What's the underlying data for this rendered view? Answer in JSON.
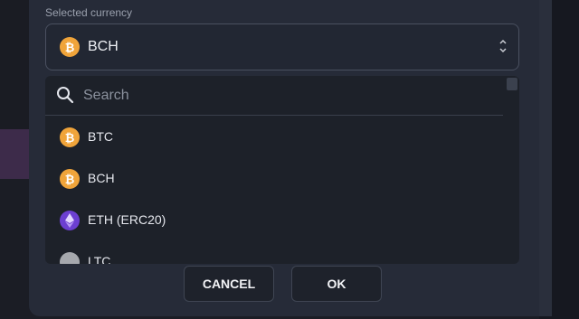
{
  "field": {
    "label": "Selected currency",
    "selected_value": "BCH",
    "selected_icon": "bitcoin-cash-icon",
    "selected_coin_glyph": "₿"
  },
  "search": {
    "placeholder": "Search"
  },
  "options": [
    {
      "label": "BTC",
      "icon": "bitcoin-icon",
      "glyph": "₿"
    },
    {
      "label": "BCH",
      "icon": "bitcoin-cash-icon",
      "glyph": "₿"
    },
    {
      "label": "ETH (ERC20)",
      "icon": "ethereum-icon"
    },
    {
      "label": "LTC",
      "icon": "litecoin-icon"
    }
  ],
  "buttons": {
    "cancel": "CANCEL",
    "ok": "OK"
  },
  "colors": {
    "coin_orange": "#f0a43a",
    "eth_purple": "#6c3fd1",
    "modal_bg": "#262b38"
  }
}
